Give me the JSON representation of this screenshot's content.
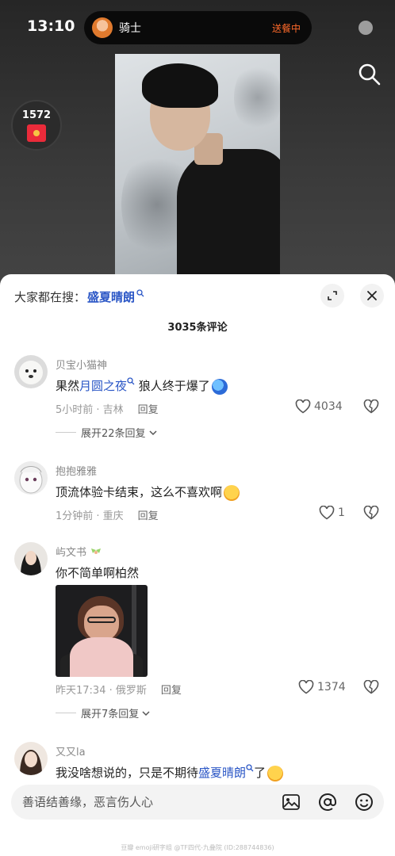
{
  "status_bar": {
    "time": "13:10"
  },
  "live_activity": {
    "name": "骑士",
    "status": "送餐中"
  },
  "video": {
    "coin_count": "1572"
  },
  "sheet": {
    "hot_search_label": "大家都在搜：",
    "hot_search_keyword": "盛夏晴朗",
    "comment_count": "3035条评论"
  },
  "comments": [
    {
      "user": "贝宝小猫神",
      "text_before": "果然",
      "link": "月圆之夜",
      "text_after": " 狼人终于爆了",
      "time_loc": "5小时前 · 吉林",
      "reply": "回复",
      "likes": "4034",
      "expand": "展开22条回复"
    },
    {
      "user": "抱抱雅雅",
      "text": "顶流体验卡结束，这么不喜欢啊",
      "time_loc": "1分钟前 · 重庆",
      "reply": "回复",
      "likes": "1"
    },
    {
      "user": "屿文书",
      "text": "你不简单啊柏然",
      "time_loc": "昨天17:34 · 俄罗斯",
      "reply": "回复",
      "likes": "1374",
      "expand": "展开7条回复"
    },
    {
      "user": "又又la",
      "text_before": "我没啥想说的，只是不期待",
      "link": "盛夏晴朗",
      "text_after": "了"
    }
  ],
  "input": {
    "placeholder": "善语结善缘，恶言伤人心"
  },
  "watermark": "豆瓣 emoji研字组 @TF四代-九叠院 (ID:288744836)",
  "colors": {
    "link": "#2a56c6",
    "live_status": "#ff6a2a",
    "envelope": "#ea2b3a"
  }
}
